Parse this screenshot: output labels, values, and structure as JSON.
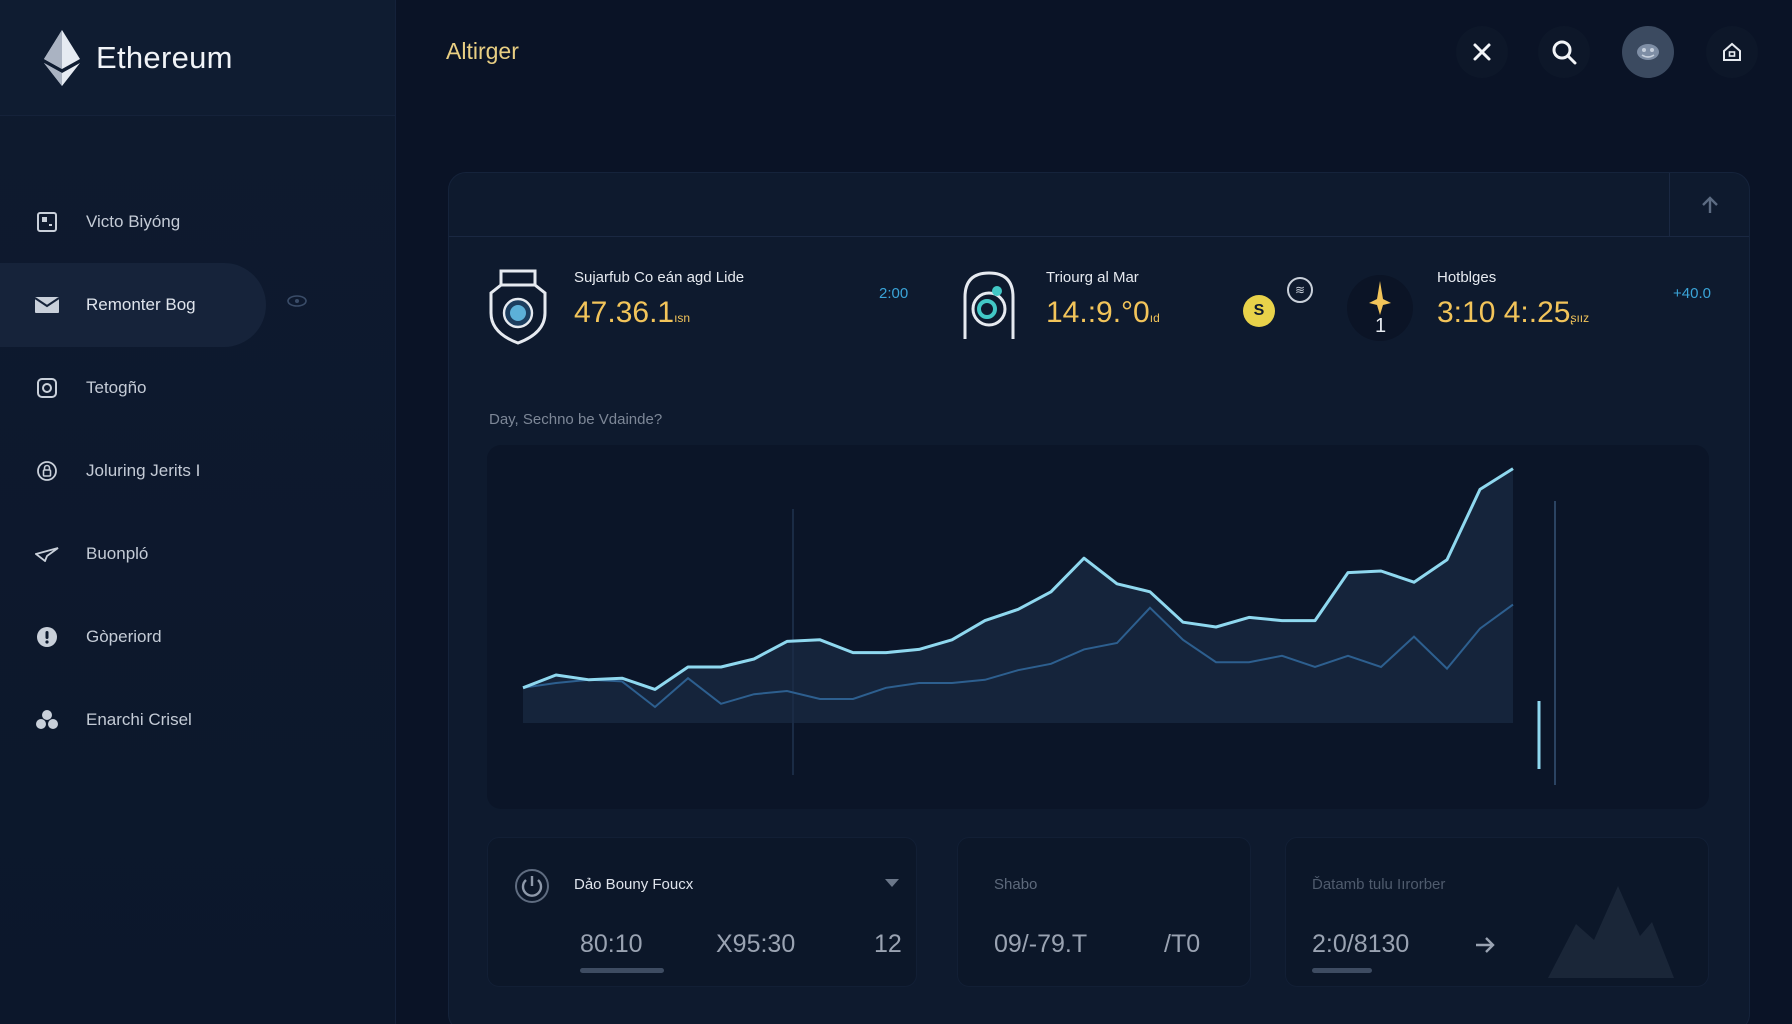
{
  "app": {
    "name": "Ethereum"
  },
  "topbar": {
    "title": "Altirger"
  },
  "sidebar": {
    "items": [
      {
        "label": "Victo Biyóng",
        "icon": "grid-square-icon",
        "active": false
      },
      {
        "label": "Remonter Bog",
        "icon": "mail-icon",
        "active": true
      },
      {
        "label": "Tetogño",
        "icon": "camera-icon",
        "active": false
      },
      {
        "label": "Joluring Jerits I",
        "icon": "lock-icon",
        "active": false
      },
      {
        "label": "Buonpló",
        "icon": "send-icon",
        "active": false
      },
      {
        "label": "Gòperiord",
        "icon": "info-icon",
        "active": false
      },
      {
        "label": "Enarchi Crisel",
        "icon": "cluster-icon",
        "active": false
      }
    ]
  },
  "stats": [
    {
      "label": "Sujarfub Co eán agd Lide",
      "value": "47.36.1",
      "unit": "ısn",
      "change": "2:00",
      "icon": "shield-icon"
    },
    {
      "label": "Triourg al Mar",
      "value": "14.:9.°0",
      "unit": "ıd",
      "change": "",
      "icon": "ring-icon"
    },
    {
      "label": "Hotblges",
      "value": "3:10 4:.25",
      "unit": "ʂıız",
      "change": "+40.0",
      "icon": "star-icon"
    }
  ],
  "mini_icon_labels": {
    "coin": "S",
    "small": "≋",
    "star_num": "1"
  },
  "chart": {
    "caption": "Day, Sechno be Vdainde?",
    "chart_data": {
      "type": "area",
      "title": "",
      "series": [
        {
          "values": [
            22,
            30,
            27,
            28,
            21,
            35,
            35,
            40,
            51,
            52,
            44,
            44,
            46,
            52,
            64,
            71,
            82,
            103,
            87,
            82,
            63,
            60,
            66,
            64,
            64,
            94,
            95,
            88,
            102,
            146,
            159
          ]
        },
        {
          "values": [
            22,
            25,
            27,
            26,
            10,
            28,
            12,
            18,
            20,
            15,
            15,
            22,
            25,
            25,
            27,
            33,
            37,
            46,
            50,
            72,
            52,
            38,
            38,
            42,
            35,
            42,
            35,
            54,
            34,
            59,
            74
          ]
        }
      ]
    }
  },
  "cards": [
    {
      "title": "Dảo Bouny Foucx",
      "values": [
        "80:10",
        "X95:30",
        "12"
      ],
      "icon": "power-icon",
      "progress": 0.3
    },
    {
      "title": "Shabo",
      "values": [
        "09/-79.T",
        "/T0"
      ],
      "progress": 0
    },
    {
      "title": "Ďatamb tulu Iırorber",
      "values": [
        "2:0/8130"
      ],
      "progress": 0.2
    }
  ],
  "colors": {
    "accent": "#f2c45a",
    "line": "#8fd8ef",
    "background": "#0a1326"
  }
}
